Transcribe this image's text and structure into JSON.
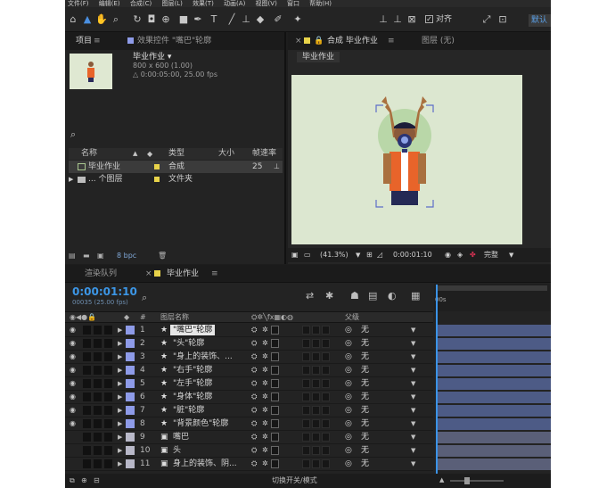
{
  "menubar": {
    "items": [
      "文件(F)",
      "编辑(E)",
      "合成(C)",
      "图层(L)",
      "效果(T)",
      "动画(A)",
      "视图(V)",
      "窗口",
      "帮助(H)"
    ]
  },
  "toolbar": {
    "snap_label": "对齐",
    "workspace_label": "默认"
  },
  "project_panel": {
    "tab_label": "项目",
    "effect_tab_label": "效果控件 \"嘴巴\"轮廓",
    "comp_name": "毕业作业 ▾",
    "comp_size": "800 x 600 (1.00)",
    "comp_duration": "△ 0:00:05:00, 25.00 fps",
    "search_icon": "search-icon",
    "columns": [
      "名称",
      "类型",
      "大小",
      "帧速率"
    ],
    "items": [
      {
        "name": "毕业作业",
        "type": "合成",
        "size": "",
        "fps": "25",
        "color": "#e8d34a"
      },
      {
        "name": "... 个图层",
        "type": "文件夹",
        "size": "",
        "fps": "",
        "color": "#e8d34a"
      }
    ],
    "bpc_label": "8 bpc"
  },
  "comp_panel": {
    "tab_label": "合成 毕业作业",
    "tab2_label": "图层 (无)",
    "subtab": "毕业作业",
    "zoom": "(41.3%)",
    "timecode": "0:00:01:10",
    "quality": "完整"
  },
  "timeline": {
    "tab_render": "渲染队列",
    "tab_comp": "毕业作业",
    "timecode": "0:00:01:10",
    "frame_info": "00035 (25.00 fps)",
    "col_layer_name": "图层名称",
    "col_parent": "父级",
    "ruler_label": "00s",
    "footer_label": "切换开关/模式",
    "layers": [
      {
        "num": "1",
        "name": "\"嘴巴\"轮廓",
        "kind": "★",
        "parent": "无",
        "label_color": "#8e9be8",
        "highlight": true,
        "visible": true
      },
      {
        "num": "2",
        "name": "\"头\"轮廓",
        "kind": "★",
        "parent": "无",
        "label_color": "#8e9be8",
        "highlight": false,
        "visible": true
      },
      {
        "num": "3",
        "name": "\"身上的装饰、...",
        "kind": "★",
        "parent": "无",
        "label_color": "#8e9be8",
        "highlight": false,
        "visible": true
      },
      {
        "num": "4",
        "name": "\"右手\"轮廓",
        "kind": "★",
        "parent": "无",
        "label_color": "#8e9be8",
        "highlight": false,
        "visible": true
      },
      {
        "num": "5",
        "name": "\"左手\"轮廓",
        "kind": "★",
        "parent": "无",
        "label_color": "#8e9be8",
        "highlight": false,
        "visible": true
      },
      {
        "num": "6",
        "name": "\"身体\"轮廓",
        "kind": "★",
        "parent": "无",
        "label_color": "#8e9be8",
        "highlight": false,
        "visible": true
      },
      {
        "num": "7",
        "name": "\"脏\"轮廓",
        "kind": "★",
        "parent": "无",
        "label_color": "#8e9be8",
        "highlight": false,
        "visible": true
      },
      {
        "num": "8",
        "name": "\"背景颜色\"轮廓",
        "kind": "★",
        "parent": "无",
        "label_color": "#8e9be8",
        "highlight": false,
        "visible": true
      },
      {
        "num": "9",
        "name": "嘴巴",
        "kind": "▣",
        "parent": "无",
        "label_color": "#b8b8c8",
        "highlight": false,
        "visible": false
      },
      {
        "num": "10",
        "name": "头",
        "kind": "▣",
        "parent": "无",
        "label_color": "#b8b8c8",
        "highlight": false,
        "visible": false
      },
      {
        "num": "11",
        "name": "身上的装饰、阴...",
        "kind": "▣",
        "parent": "无",
        "label_color": "#b8b8c8",
        "highlight": false,
        "visible": false
      }
    ]
  },
  "colors": {
    "accent": "#3b93e6",
    "canvas_bg": "#dce7d0",
    "track": "#4d5b86",
    "label_shape": "#8e9be8",
    "shirt": "#e8642a"
  }
}
